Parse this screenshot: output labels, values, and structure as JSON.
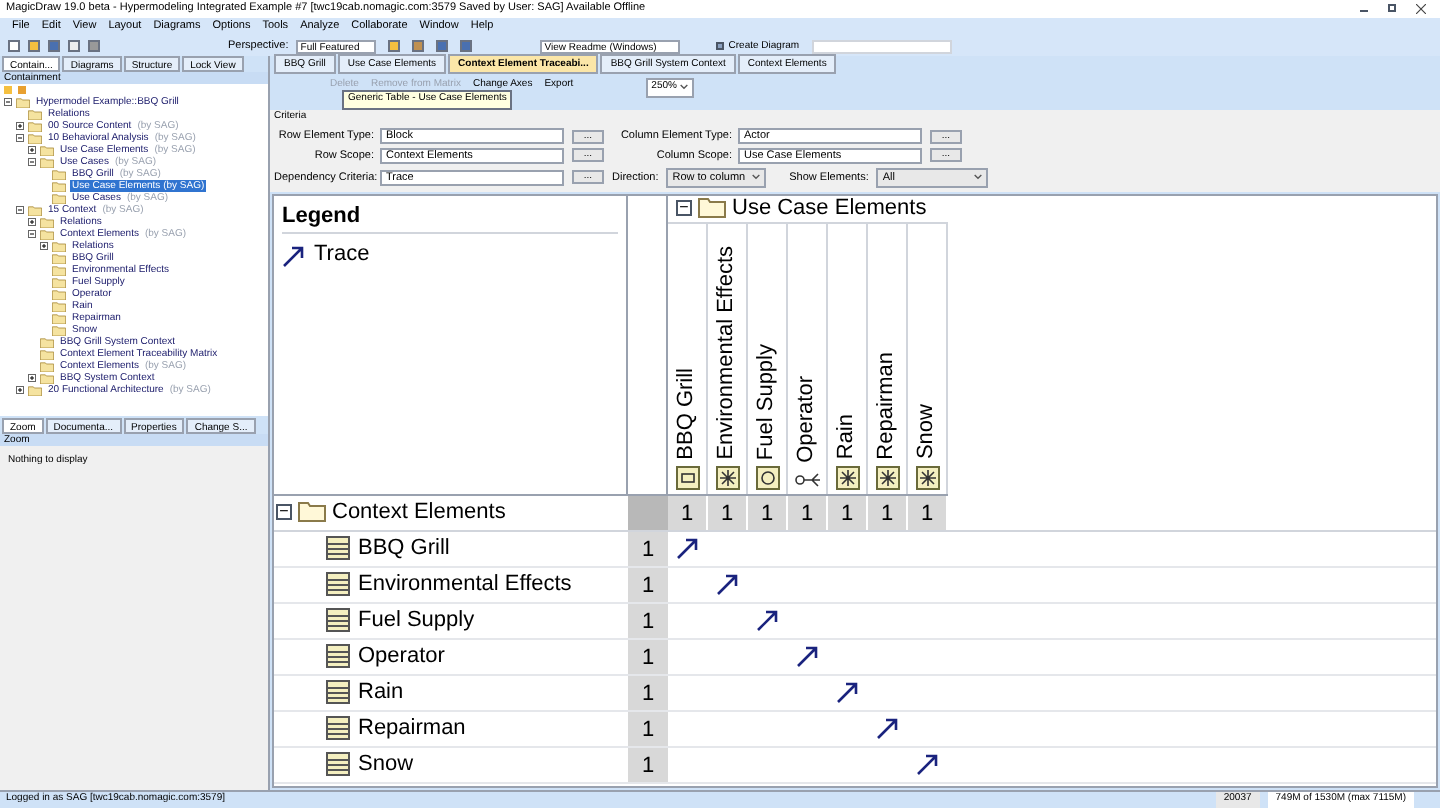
{
  "window": {
    "title": "MagicDraw 19.0 beta - Hypermodeling Integrated Example #7 [twc19cab.nomagic.com:3579 Saved by User: SAG] Available Offline"
  },
  "menu": [
    "File",
    "Edit",
    "View",
    "Layout",
    "Diagrams",
    "Options",
    "Tools",
    "Analyze",
    "Collaborate",
    "Window",
    "Help"
  ],
  "toolbar": {
    "perspective_label": "Perspective:",
    "perspective": "Full Featured",
    "readme": "View Readme (Windows)",
    "create_diagram": "Create Diagram"
  },
  "left_tabs": [
    {
      "label": "Contain...",
      "selected": true
    },
    {
      "label": "Diagrams",
      "selected": false
    },
    {
      "label": "Structure",
      "selected": false
    },
    {
      "label": "Lock View",
      "selected": false
    }
  ],
  "containment": {
    "title": "Containment",
    "tree": [
      {
        "label": "Hypermodel Example::BBQ Grill",
        "expanded": true,
        "selected": false,
        "children": [
          {
            "label": "Relations",
            "selected": false
          },
          {
            "label": "00 Source Content",
            "owner": "(by SAG)",
            "expanded": false,
            "selected": false
          },
          {
            "label": "10 Behavioral Analysis",
            "owner": "(by SAG)",
            "expanded": true,
            "selected": false,
            "children": [
              {
                "label": "Use Case Elements",
                "owner": "(by SAG)",
                "expanded": false,
                "selected": false
              },
              {
                "label": "Use Cases",
                "owner": "(by SAG)",
                "expanded": true,
                "selected": false,
                "children": [
                  {
                    "label": "BBQ Grill",
                    "owner": "(by SAG)",
                    "selected": false
                  },
                  {
                    "label": "Use Case Elements (by SAG)",
                    "selected": true
                  },
                  {
                    "label": "Use Cases",
                    "owner": "(by SAG)",
                    "selected": false
                  }
                ]
              }
            ]
          },
          {
            "label": "15 Context",
            "owner": "(by SAG)",
            "expanded": true,
            "selected": false,
            "children": [
              {
                "label": "Relations",
                "expanded": false,
                "selected": false
              },
              {
                "label": "Context Elements",
                "owner": "(by SAG)",
                "expanded": true,
                "selected": false,
                "children": [
                  {
                    "label": "Relations",
                    "expanded": false,
                    "selected": false
                  },
                  {
                    "label": "BBQ Grill",
                    "selected": false
                  },
                  {
                    "label": "Environmental Effects",
                    "selected": false
                  },
                  {
                    "label": "Fuel Supply",
                    "selected": false
                  },
                  {
                    "label": "Operator",
                    "selected": false
                  },
                  {
                    "label": "Rain",
                    "selected": false
                  },
                  {
                    "label": "Repairman",
                    "selected": false
                  },
                  {
                    "label": "Snow",
                    "selected": false
                  }
                ]
              },
              {
                "label": "BBQ Grill System Context",
                "selected": false
              },
              {
                "label": "Context Element Traceability Matrix",
                "selected": false
              },
              {
                "label": "Context Elements",
                "owner": "(by SAG)",
                "selected": false
              },
              {
                "label": "BBQ System Context",
                "expanded": false,
                "selected": false
              }
            ]
          },
          {
            "label": "20 Functional Architecture",
            "owner": "(by SAG)",
            "expanded": false,
            "selected": false
          }
        ]
      }
    ]
  },
  "bottom_tabs": [
    {
      "label": "Zoom",
      "selected": true
    },
    {
      "label": "Documenta...",
      "selected": false
    },
    {
      "label": "Properties",
      "selected": false
    },
    {
      "label": "Change S...",
      "selected": false
    }
  ],
  "zoom_panel": {
    "title": "Zoom",
    "message": "Nothing to display"
  },
  "doc_tabs": [
    {
      "label": "BBQ Grill",
      "selected": false
    },
    {
      "label": "Use Case Elements",
      "selected": false
    },
    {
      "label": "Context Element Traceabi...",
      "selected": true
    },
    {
      "label": "BBQ Grill System Context",
      "selected": false
    },
    {
      "label": "Context Elements",
      "selected": false
    }
  ],
  "matrix_toolbar": {
    "delete": "Delete",
    "remove": "Remove from Matrix",
    "change_axes": "Change Axes",
    "export": "Export",
    "zoom": "250%",
    "tooltip": "Generic Table - Use Case Elements"
  },
  "criteria": {
    "title": "Criteria",
    "row_element_type": {
      "label": "Row Element Type:",
      "value": "Block"
    },
    "column_element_type": {
      "label": "Column Element Type:",
      "value": "Actor"
    },
    "row_scope": {
      "label": "Row Scope:",
      "value": "Context Elements"
    },
    "column_scope": {
      "label": "Column Scope:",
      "value": "Use Case Elements"
    },
    "dependency_criteria": {
      "label": "Dependency Criteria:",
      "value": "Trace"
    },
    "direction": {
      "label": "Direction:",
      "value": "Row to column"
    },
    "show_elements": {
      "label": "Show Elements:",
      "value": "All"
    },
    "more": "..."
  },
  "matrix": {
    "legend_title": "Legend",
    "legend_items": [
      "Trace"
    ],
    "column_group": "Use Case Elements",
    "row_group": "Context Elements",
    "expand_mark": "−",
    "columns": [
      {
        "name": "BBQ Grill",
        "kind": "system",
        "count": "1"
      },
      {
        "name": "Environmental Effects",
        "kind": "element",
        "count": "1"
      },
      {
        "name": "Fuel Supply",
        "kind": "face",
        "count": "1"
      },
      {
        "name": "Operator",
        "kind": "actor",
        "count": "1"
      },
      {
        "name": "Rain",
        "kind": "element",
        "count": "1"
      },
      {
        "name": "Repairman",
        "kind": "element",
        "count": "1"
      },
      {
        "name": "Snow",
        "kind": "element",
        "count": "1"
      }
    ],
    "rows": [
      {
        "name": "BBQ Grill",
        "count": "1",
        "cells": [
          true,
          false,
          false,
          false,
          false,
          false,
          false
        ]
      },
      {
        "name": "Environmental Effects",
        "count": "1",
        "cells": [
          false,
          true,
          false,
          false,
          false,
          false,
          false
        ]
      },
      {
        "name": "Fuel Supply",
        "count": "1",
        "cells": [
          false,
          false,
          true,
          false,
          false,
          false,
          false
        ]
      },
      {
        "name": "Operator",
        "count": "1",
        "cells": [
          false,
          false,
          false,
          true,
          false,
          false,
          false
        ]
      },
      {
        "name": "Rain",
        "count": "1",
        "cells": [
          false,
          false,
          false,
          false,
          true,
          false,
          false
        ]
      },
      {
        "name": "Repairman",
        "count": "1",
        "cells": [
          false,
          false,
          false,
          false,
          false,
          true,
          false
        ]
      },
      {
        "name": "Snow",
        "count": "1",
        "cells": [
          false,
          false,
          false,
          false,
          false,
          false,
          true
        ]
      }
    ]
  },
  "status_bar": {
    "login": "Logged in as SAG [twc19cab.nomagic.com:3579]",
    "counter": "20037",
    "memory": "749M of 1530M (max 7115M)"
  }
}
